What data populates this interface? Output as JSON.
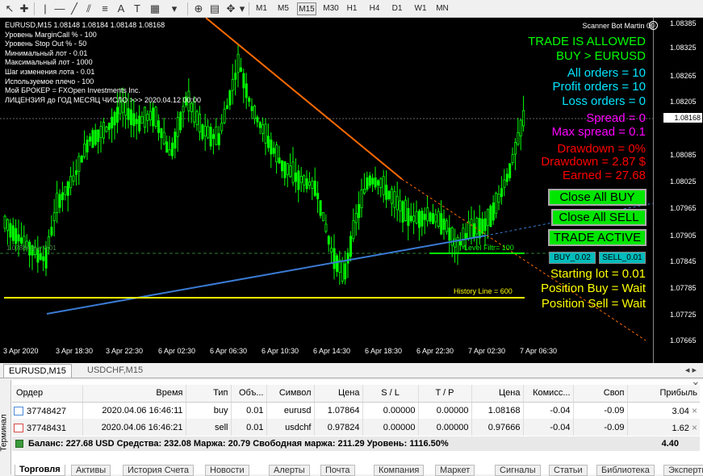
{
  "toolbar": {
    "timeframes": [
      "M1",
      "M5",
      "M15",
      "M30",
      "H1",
      "H4",
      "D1",
      "W1",
      "MN"
    ]
  },
  "chart": {
    "symbol_line": "EURUSD,M15  1.08148 1.08184 1.08148 1.08168",
    "info": [
      "Уровень MarginCall % - 100",
      "Уровень Stop Out % - 50",
      "Минимальный лот - 0.01",
      "Максимальный лот - 1000",
      "Шаг изменения лота - 0.01",
      "Используемое плечо - 100",
      "Мой БРОКЕР  = FXOpen Investments Inc.",
      "ЛИЦЕНЗИЯ до ГОД  МЕСЯЦ  ЧИСЛО >>> 2020.04.12 00:00"
    ],
    "scanner": "Scanner Bot Martin 007",
    "trade_allowed": "TRADE IS ALLOWED",
    "direction": "BUY > EURUSD",
    "all_orders": "All orders = 10",
    "profit_orders": "Profit orders = 10",
    "loss_orders": "Loss orders = 0",
    "spread": "Spread =  0",
    "max_spread": "Max spread =  0.1",
    "drawdown_pct": "Drawdown  = 0%",
    "drawdown_usd": "Drawdown = 2.87 $",
    "earned": "Earned = 27.68",
    "close_all_buy": "Close All BUY",
    "close_all_sell": "Close All SELL",
    "trade_active": "TRADE ACTIVE",
    "buy_btn": "BUY_0.02",
    "sell_btn": "SELL_0.01",
    "starting_lot": "Starting lot = 0.01",
    "position_buy": "Position Buy  = Wait",
    "position_sell": "Position Sell = Wait",
    "level_filter": "Level Filtr= 100",
    "history_line": "History Line = 600",
    "left_label": "1.07884 buy 0.01",
    "prices": [
      "1.08385",
      "1.08325",
      "1.08265",
      "1.08205",
      "1.08145",
      "1.08085",
      "1.08025",
      "1.07965",
      "1.07905",
      "1.07845",
      "1.07785",
      "1.07725",
      "1.07665"
    ],
    "current_price": "1.08168",
    "times": [
      "3 Apr 2020",
      "3 Apr 18:30",
      "3 Apr 22:30",
      "6 Apr 02:30",
      "6 Apr 06:30",
      "6 Apr 10:30",
      "6 Apr 14:30",
      "6 Apr 18:30",
      "6 Apr 22:30",
      "7 Apr 02:30",
      "7 Apr 06:30"
    ],
    "colors": {
      "candles": "#00ff00",
      "trend_orange": "#ff6a00",
      "trend_blue": "#3a7bd5",
      "history_line": "#ffff00",
      "trade_allowed": "#00ff00",
      "cyan_text": "#00e5ff",
      "magenta_text": "#ff00ff",
      "red_text": "#ff0000",
      "yellow_text": "#ffff00"
    }
  },
  "chart_tabs": [
    "EURUSD,M15",
    "USDCHF,M15"
  ],
  "terminal": {
    "side_title": "Терминал",
    "headers": [
      "Ордер",
      "Время",
      "Тип",
      "Объ...",
      "Символ",
      "Цена",
      "S / L",
      "T / P",
      "Цена",
      "Комисс...",
      "Своп",
      "Прибыль"
    ],
    "rows": [
      [
        "37748427",
        "2020.04.06 16:46:11",
        "buy",
        "0.01",
        "eurusd",
        "1.07864",
        "0.00000",
        "0.00000",
        "1.08168",
        "-0.04",
        "-0.09",
        "3.04"
      ],
      [
        "37748431",
        "2020.04.06 16:46:21",
        "sell",
        "0.01",
        "usdchf",
        "0.97824",
        "0.00000",
        "0.00000",
        "0.97666",
        "-0.04",
        "-0.09",
        "1.62"
      ]
    ],
    "balance_line": "Баланс: 227.68 USD  Средства: 232.08  Маржа: 20.79  Свободная маржа: 211.29  Уровень: 1116.50%",
    "balance_total": "4.40",
    "bottom_tabs": [
      "Торговля",
      "Активы",
      "История Счета",
      "Новости",
      "Алерты",
      "Почта",
      "Компания",
      "Маркет",
      "Сигналы",
      "Статьи",
      "Библиотека",
      "Эксперты"
    ]
  }
}
